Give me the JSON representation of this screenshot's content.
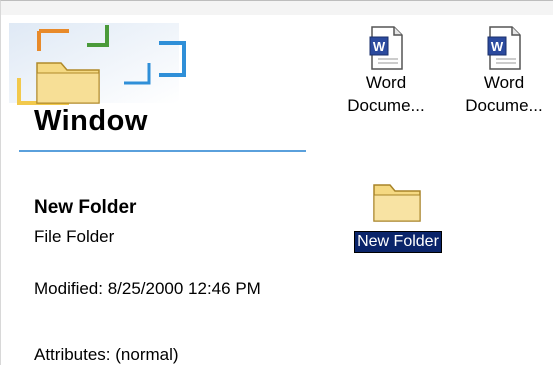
{
  "window": {
    "title": "Window"
  },
  "selection": {
    "name": "New Folder",
    "type": "File Folder",
    "modified": "Modified: 8/25/2000 12:46 PM",
    "attributes": "Attributes: (normal)"
  },
  "files": [
    {
      "label_line1": "Word",
      "label_line2": "Docume...",
      "icon": "word-document-icon"
    },
    {
      "label_line1": "Word",
      "label_line2": "Docume...",
      "icon": "word-document-icon"
    },
    {
      "label": "New Folder",
      "icon": "folder-icon",
      "selected": true
    }
  ],
  "colors": {
    "selection_bg": "#0a246a",
    "rule": "#5aa0dc",
    "folder": "#f5d982"
  }
}
